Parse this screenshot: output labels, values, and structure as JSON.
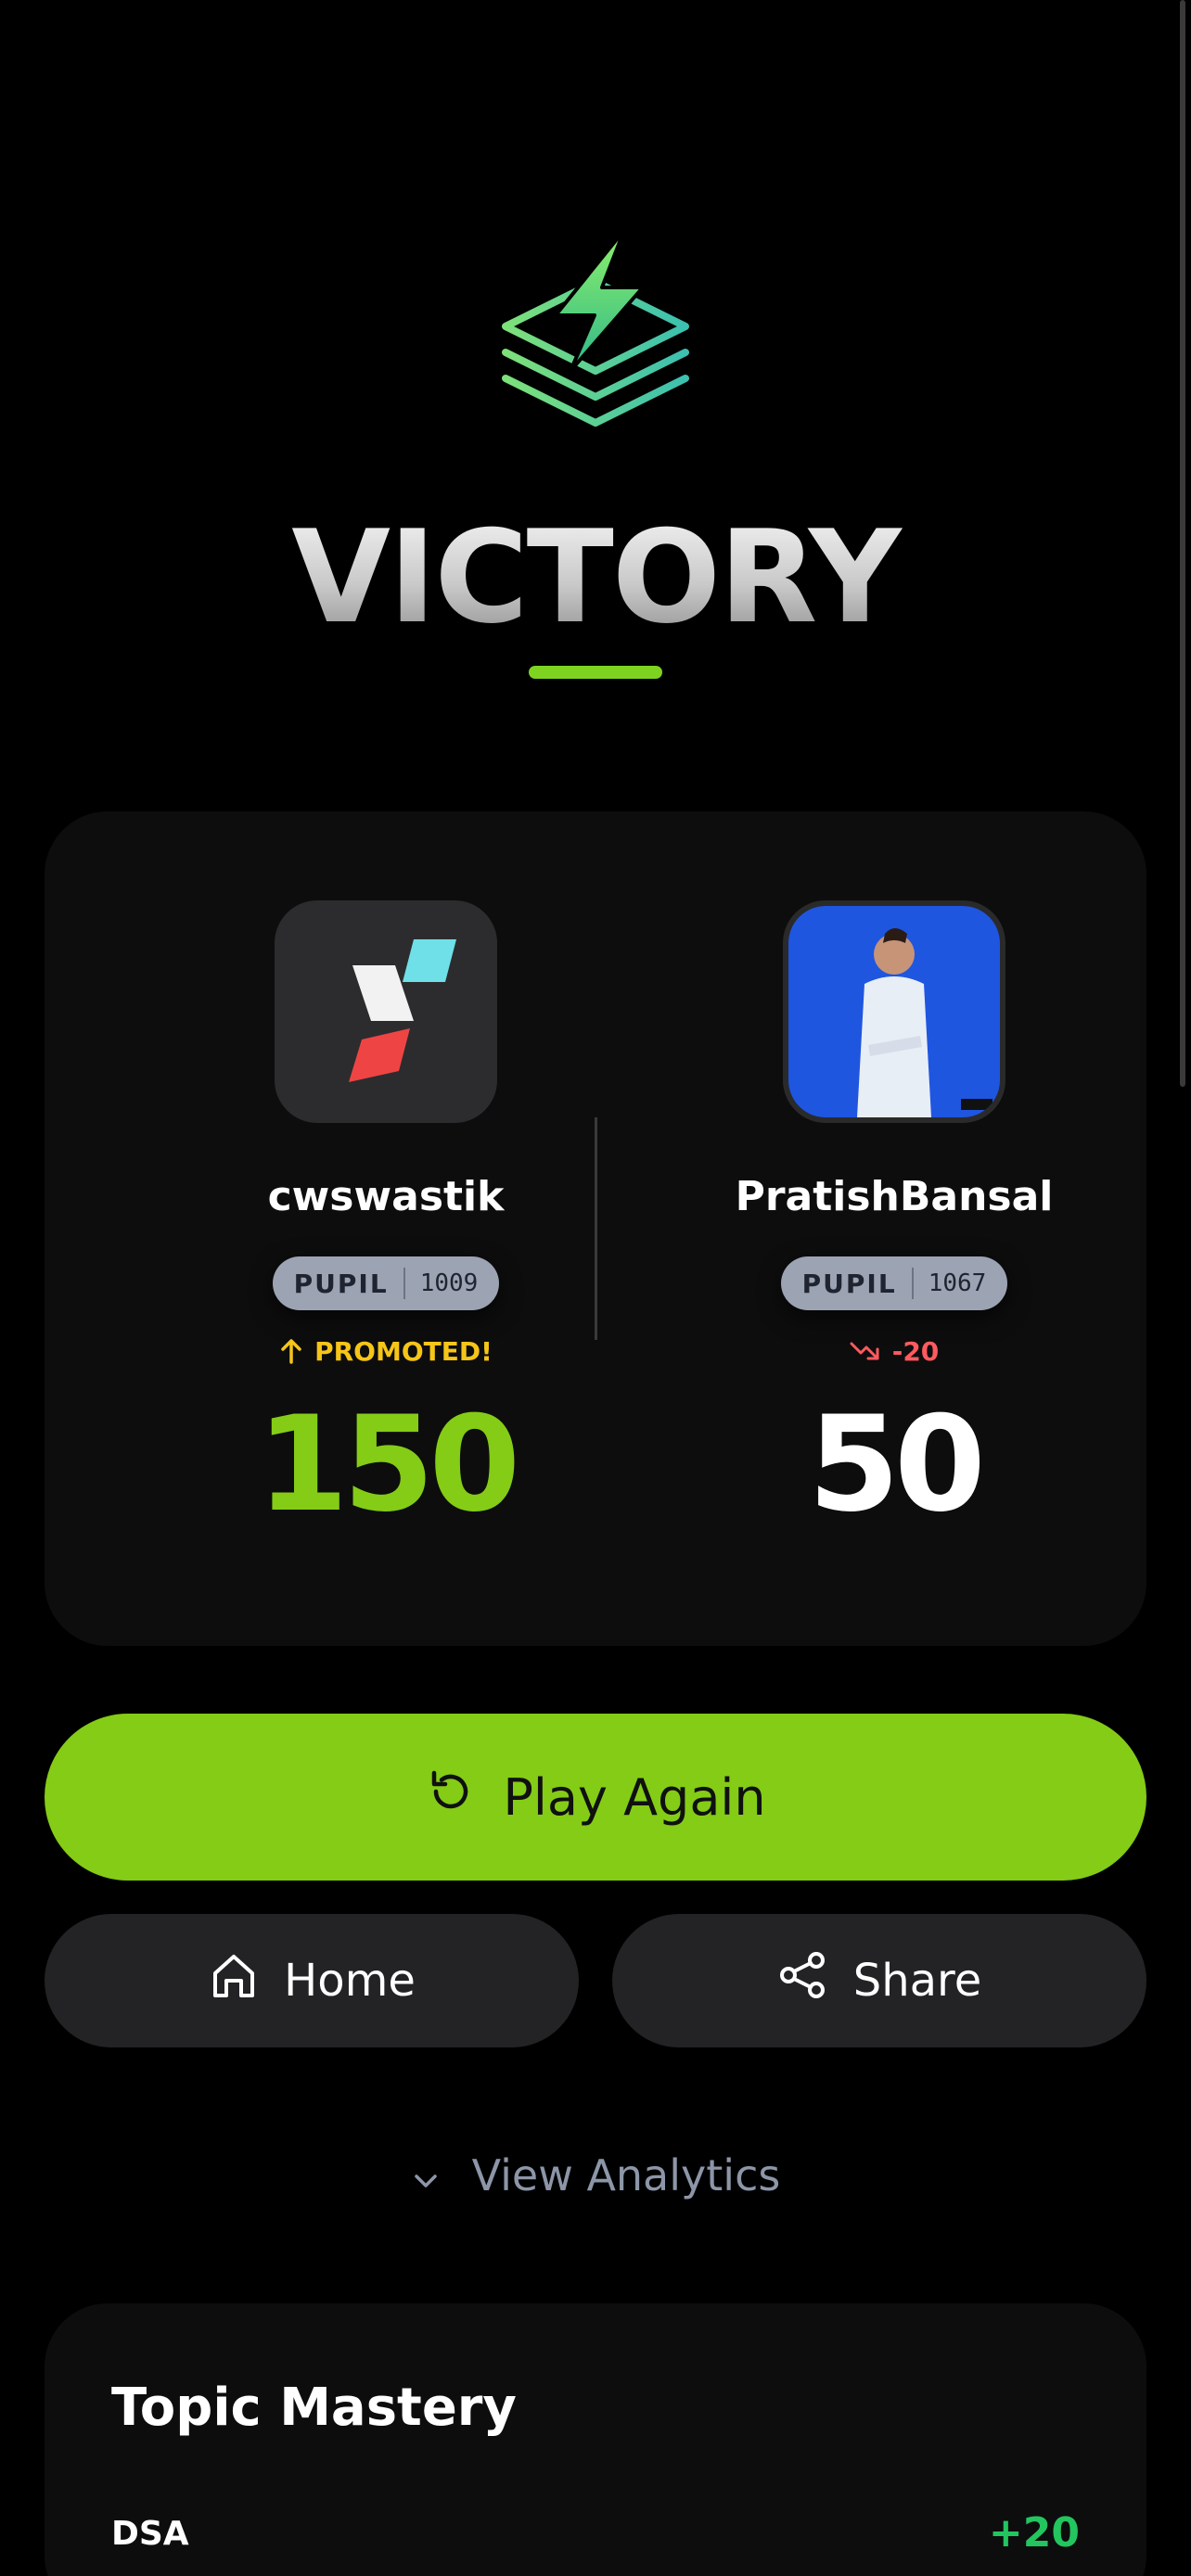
{
  "result": {
    "title": "VICTORY",
    "accent_color": "#84cc16"
  },
  "player_left": {
    "username": "cwswastik",
    "rank": "PUPIL",
    "rating": "1009",
    "status": "PROMOTED!",
    "status_icon": "arrow-up-icon",
    "score": "150"
  },
  "player_right": {
    "username": "PratishBansal",
    "rank": "PUPIL",
    "rating": "1067",
    "status": "-20",
    "status_icon": "trend-down-icon",
    "score": "50"
  },
  "actions": {
    "play_again": "Play Again",
    "home": "Home",
    "share": "Share",
    "view_analytics": "View Analytics"
  },
  "topic_mastery": {
    "title": "Topic Mastery",
    "rows": [
      {
        "topic": "DSA",
        "delta": "+20"
      }
    ]
  }
}
